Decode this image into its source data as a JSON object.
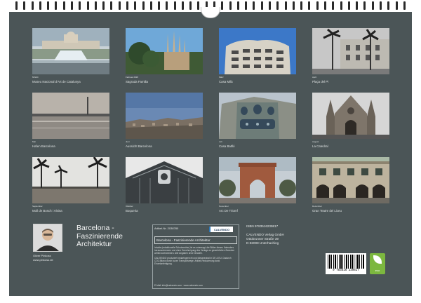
{
  "photos": [
    {
      "id": "museu",
      "meta": "MNAC",
      "caption": "Museu Nacional d'Art de Catalunya"
    },
    {
      "id": "sagrada",
      "meta": "Februar 2026",
      "caption": "Sagrada Familia"
    },
    {
      "id": "casamila",
      "meta": "März",
      "caption": "Casa Milà"
    },
    {
      "id": "placa",
      "meta": "April",
      "caption": "Plaça del Pi"
    },
    {
      "id": "hafen",
      "meta": "Mai",
      "caption": "Hafen Barcelona"
    },
    {
      "id": "aussicht",
      "meta": "Juni",
      "caption": "Aussicht Barcelona"
    },
    {
      "id": "batllo",
      "meta": "Juli",
      "caption": "Casa Batlló"
    },
    {
      "id": "catedral",
      "meta": "August",
      "caption": "La Catedral"
    },
    {
      "id": "moll",
      "meta": "September",
      "caption": "Moll de Bosch i Alsina"
    },
    {
      "id": "boqueria",
      "meta": "Oktober",
      "caption": "Boqueria"
    },
    {
      "id": "arc",
      "meta": "November",
      "caption": "Arc De Triomf"
    },
    {
      "id": "liceu",
      "meta": "Dezember",
      "caption": "Gran Teatre del Liceu"
    }
  ],
  "author": {
    "name": "Oliver Pinkoss",
    "web": "www.pinkoss.de"
  },
  "title": "Barcelona - Faszinierende Architektur",
  "info": {
    "artnr": "Artikel-Nr. 2038780",
    "logo": "CALVENDO",
    "product_title": "Barcelona - Faszinierende Architektur",
    "text1": "Inhalte (redaktionelle Schutzrechte) ist es untersagt, die Bilder dieses Kalenders herauszutrennen und ohne Genehmigung des Verlags zu gewerblichen Zwecken weiterzuverwenden. Alle Angaben ohne Gewähr.",
    "text2": "CALVENDO produziert bedarfsgerecht und klimaneutral in DE & EU. Dadurch CO2-Bilanz durch kurze Transportwege. Artikel-Reduzierung dank Einzelanfertigung.",
    "contact": "E-Mail: info@calvendo.com · www.calvendo.com"
  },
  "publisher": {
    "isbn": "ISBN 9783516239817",
    "line1": "CALVENDO Verlag GmbH",
    "line2": "Ottobrunner Straße 39",
    "line3": "D-82008 Unterhaching"
  },
  "barcode": {
    "digits": "9 783516 239817"
  },
  "eco": {
    "label": "eco"
  }
}
